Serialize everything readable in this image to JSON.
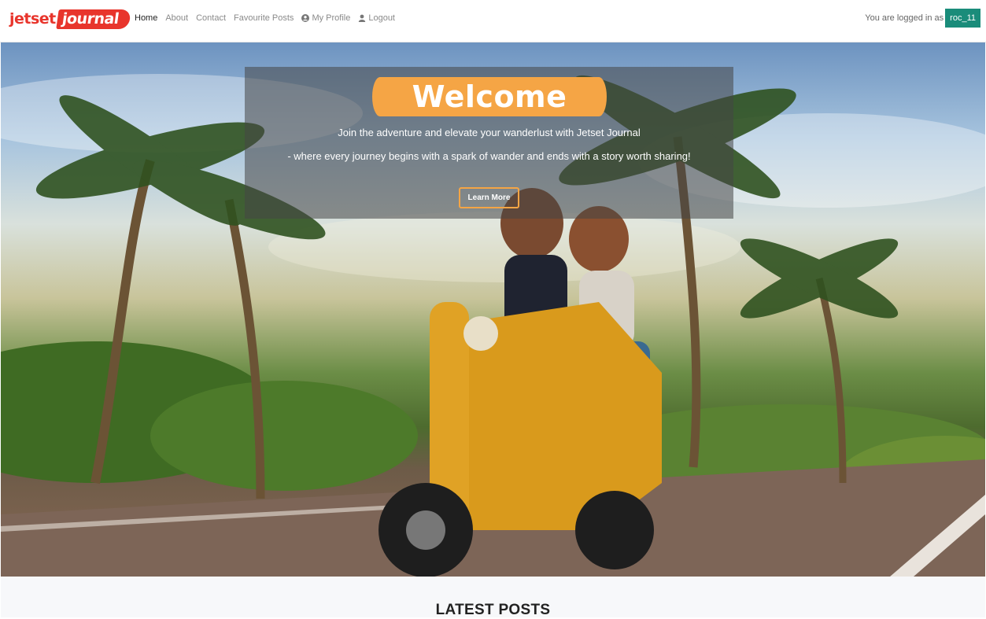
{
  "brand": {
    "part1": "jetset",
    "part2": "journal"
  },
  "nav": {
    "items": [
      {
        "label": "Home",
        "active": true
      },
      {
        "label": "About"
      },
      {
        "label": "Contact"
      },
      {
        "label": "Favourite Posts"
      },
      {
        "label": "My Profile",
        "icon": "user-circle-icon"
      },
      {
        "label": "Logout",
        "icon": "user-icon"
      }
    ],
    "login_text": "You are logged in as",
    "username": "roc_11"
  },
  "hero": {
    "welcome": "Welcome",
    "tagline_1": "Join the adventure and elevate your wanderlust with Jetset Journal",
    "tagline_2": "- where every journey begins with a spark of wander and ends with a story worth sharing!",
    "button_label": "Learn More",
    "image_description": "hero-photo-scooter-palm-trees"
  },
  "posts": {
    "title": "LATEST POSTS"
  },
  "colors": {
    "brand_red": "#e8352c",
    "accent_orange": "#f5a545",
    "user_badge": "#1a8c7a"
  }
}
